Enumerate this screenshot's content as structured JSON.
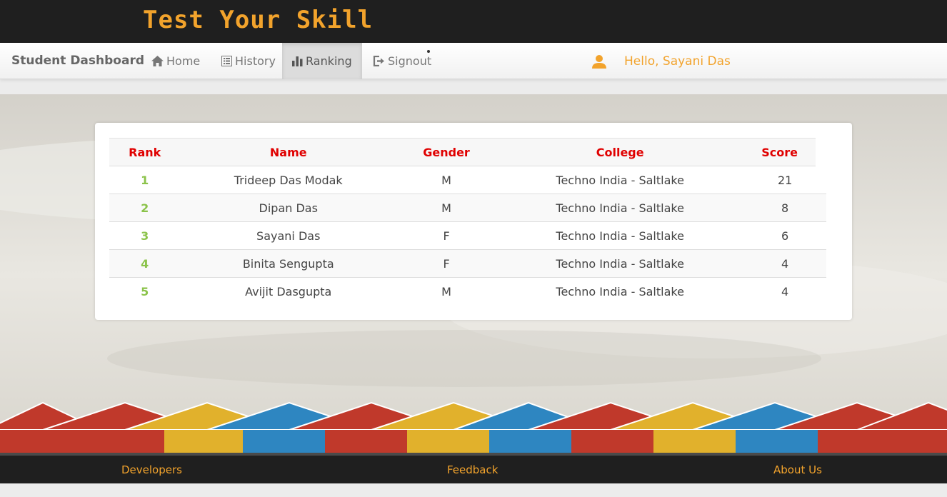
{
  "header": {
    "brand": "Test Your Skill"
  },
  "nav": {
    "title": "Student Dashboard",
    "items": [
      {
        "label": "Home",
        "icon": "home-icon"
      },
      {
        "label": "History",
        "icon": "list-icon"
      },
      {
        "label": "Ranking",
        "icon": "bar-chart-icon",
        "active": true
      },
      {
        "label": "Signout",
        "icon": "signout-icon"
      }
    ],
    "greeting": "Hello, Sayani Das",
    "accent_color": "#f2a32c"
  },
  "ranking_table": {
    "headers": [
      "Rank",
      "Name",
      "Gender",
      "College",
      "Score"
    ],
    "rows": [
      [
        "1",
        "Trideep Das Modak",
        "M",
        "Techno India - Saltlake",
        "21"
      ],
      [
        "2",
        "Dipan Das",
        "M",
        "Techno India - Saltlake",
        "8"
      ],
      [
        "3",
        "Sayani Das",
        "F",
        "Techno India - Saltlake",
        "6"
      ],
      [
        "4",
        "Binita Sengupta",
        "F",
        "Techno India - Saltlake",
        "4"
      ],
      [
        "5",
        "Avijit Dasgupta",
        "M",
        "Techno India - Saltlake",
        "4"
      ]
    ],
    "header_color": "#e00000",
    "rank_color": "#8bc34a"
  },
  "footer": {
    "links": [
      "Developers",
      "Feedback",
      "About Us"
    ]
  }
}
